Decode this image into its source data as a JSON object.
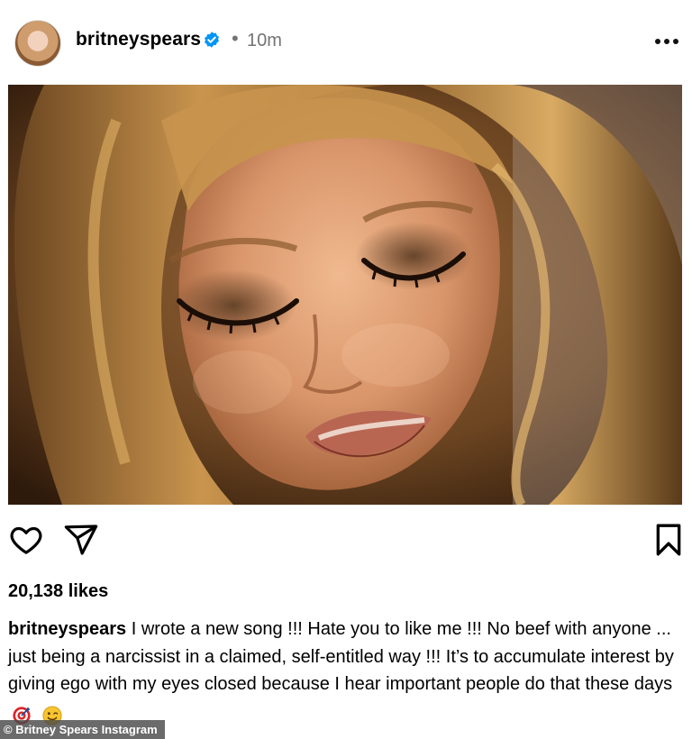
{
  "post": {
    "username": "britneyspears",
    "dot": "•",
    "time": "10m",
    "likes": "20,138 likes",
    "caption_user": "britneyspears",
    "caption_text": " I wrote a new song !!! Hate you to like me !!! No beef with anyone ... just being a narcissist in a claimed, self-entitled way !!! It’s to accumulate interest by giving ego with my eyes closed because I hear important people do that these days"
  },
  "icons": {
    "verified": "verified-badge-icon",
    "more": "more-options-icon",
    "like": "heart-icon",
    "share": "send-icon",
    "save": "bookmark-icon",
    "emoji_1": "dart-target-emoji",
    "emoji_2": "winking-face-emoji"
  },
  "colors": {
    "verified_blue": "#0095f6",
    "meta_gray": "#737373",
    "text_black": "#000000"
  },
  "credit": {
    "text": "© Britney Spears Instagram"
  }
}
